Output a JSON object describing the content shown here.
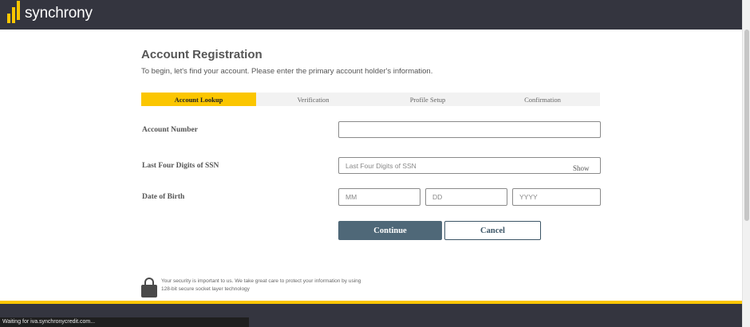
{
  "header": {
    "logo_text": "synchrony",
    "brand_color": "#fbc600",
    "header_color": "#34353f"
  },
  "page": {
    "title": "Account Registration",
    "subtitle": "To begin, let's find your account. Please enter the primary account holder's information."
  },
  "steps": [
    {
      "label": "Account Lookup",
      "active": true
    },
    {
      "label": "Verification",
      "active": false
    },
    {
      "label": "Profile Setup",
      "active": false
    },
    {
      "label": "Confirmation",
      "active": false
    }
  ],
  "form": {
    "account_number": {
      "label": "Account Number",
      "value": "",
      "placeholder": ""
    },
    "ssn": {
      "label": "Last Four Digits of SSN",
      "value": "",
      "placeholder": "Last Four Digits of SSN",
      "toggle_label": "Show"
    },
    "dob": {
      "label": "Date of Birth",
      "month_placeholder": "MM",
      "day_placeholder": "DD",
      "year_placeholder": "YYYY"
    },
    "continue_label": "Continue",
    "cancel_label": "Cancel"
  },
  "security": {
    "icon": "lock-icon",
    "text": "Your security is important to us. We take great care to protect your information by using 128-bit secure socket layer technology"
  },
  "status_bar": {
    "text": "Waiting for iva.synchronycredit.com..."
  }
}
